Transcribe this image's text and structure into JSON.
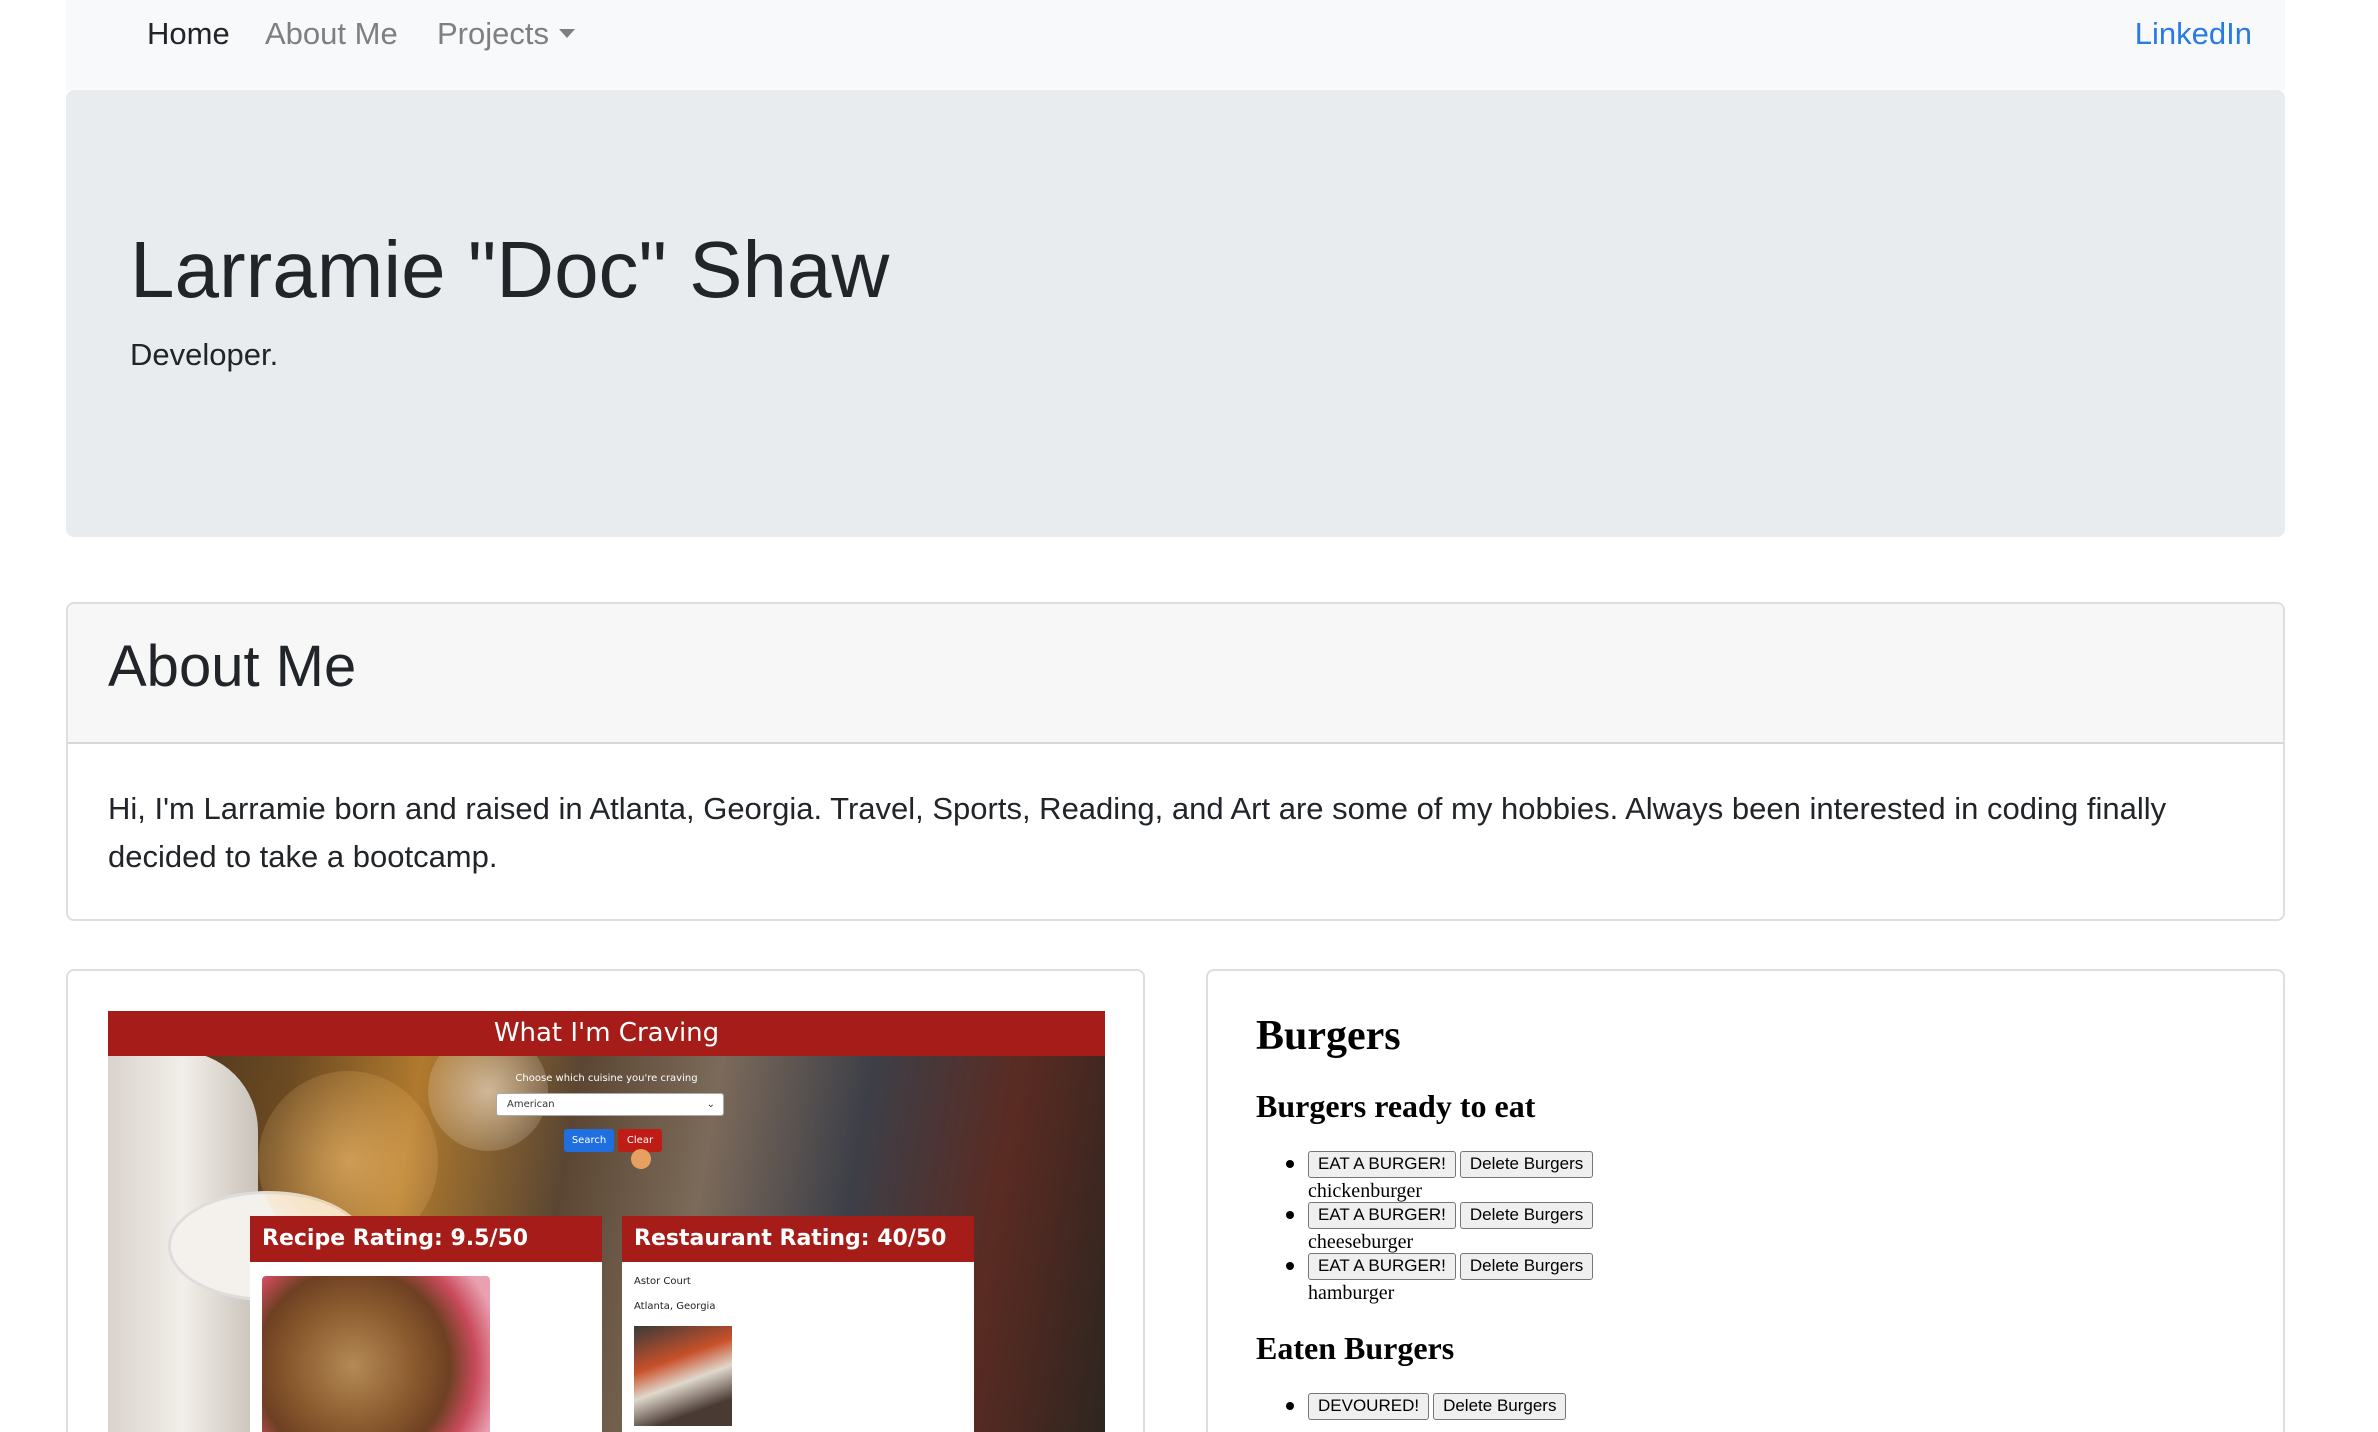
{
  "nav": {
    "home": "Home",
    "about": "About Me",
    "projects": "Projects",
    "linkedin": "LinkedIn"
  },
  "hero": {
    "title": "Larramie \"Doc\" Shaw",
    "subtitle": "Developer."
  },
  "about": {
    "title": "About Me",
    "text": "Hi, I'm Larramie born and raised in Atlanta, Georgia. Travel, Sports, Reading, and Art are some of my hobbies. Always been interested in coding finally decided to take a bootcamp."
  },
  "craving": {
    "title": "What I'm Craving",
    "prompt": "Choose which cuisine you're craving",
    "selected": "American",
    "search_label": "Search",
    "clear_label": "Clear",
    "recipe_rating": "Recipe Rating: 9.5/50",
    "restaurant_rating": "Restaurant Rating: 40/50",
    "restaurant_name": "Astor Court",
    "restaurant_location": "Atlanta, Georgia"
  },
  "burgers": {
    "title": "Burgers",
    "ready_heading": "Burgers ready to eat",
    "eat_label": "EAT A BURGER!",
    "delete_label": "Delete Burgers",
    "ready_items": [
      {
        "name": "chickenburger"
      },
      {
        "name": "cheeseburger"
      },
      {
        "name": "hamburger"
      }
    ],
    "eaten_heading": "Eaten Burgers",
    "devoured_label": "DEVOURED!"
  },
  "colors": {
    "link": "#2a7ae4",
    "nav_bg": "#f8f9fa",
    "hero_bg": "#e9ecef",
    "craving_red": "#a61c18"
  },
  "icons": {
    "projects_dropdown": "caret-down-icon"
  }
}
